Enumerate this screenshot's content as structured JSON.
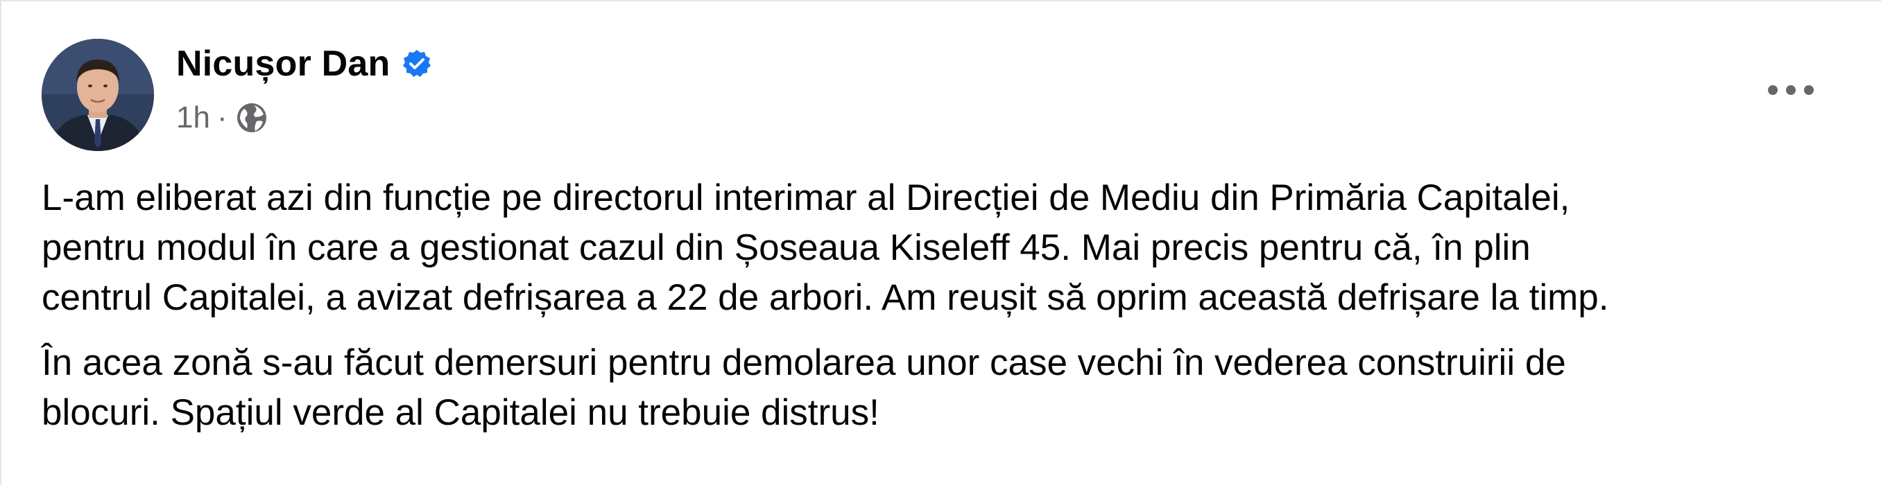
{
  "post": {
    "author": {
      "name": "Nicușor Dan",
      "verified": true,
      "avatar_icon": "person-portrait"
    },
    "meta": {
      "time": "1h",
      "separator": "·",
      "audience_icon": "globe-icon"
    },
    "more_icon": "more-options-icon",
    "paragraphs": [
      {
        "lines": [
          "L-am eliberat azi din funcție pe directorul interimar al Direcției de Mediu din Primăria Capitalei,",
          "pentru modul în care a gestionat cazul din Șoseaua Kiseleff 45. Mai precis pentru că, în plin",
          "centrul Capitalei, a avizat defrișarea a 22 de arbori. Am reușit să oprim această defrișare la timp."
        ]
      },
      {
        "lines": [
          "În acea zonă s-au făcut demersuri pentru demolarea unor case vechi în vederea construirii de",
          "blocuri. Spațiul verde al Capitalei nu trebuie distrus!"
        ]
      }
    ]
  },
  "colors": {
    "text": "#050505",
    "secondary": "#65676b",
    "verified_blue": "#1877f2",
    "border": "#e4e6eb"
  }
}
